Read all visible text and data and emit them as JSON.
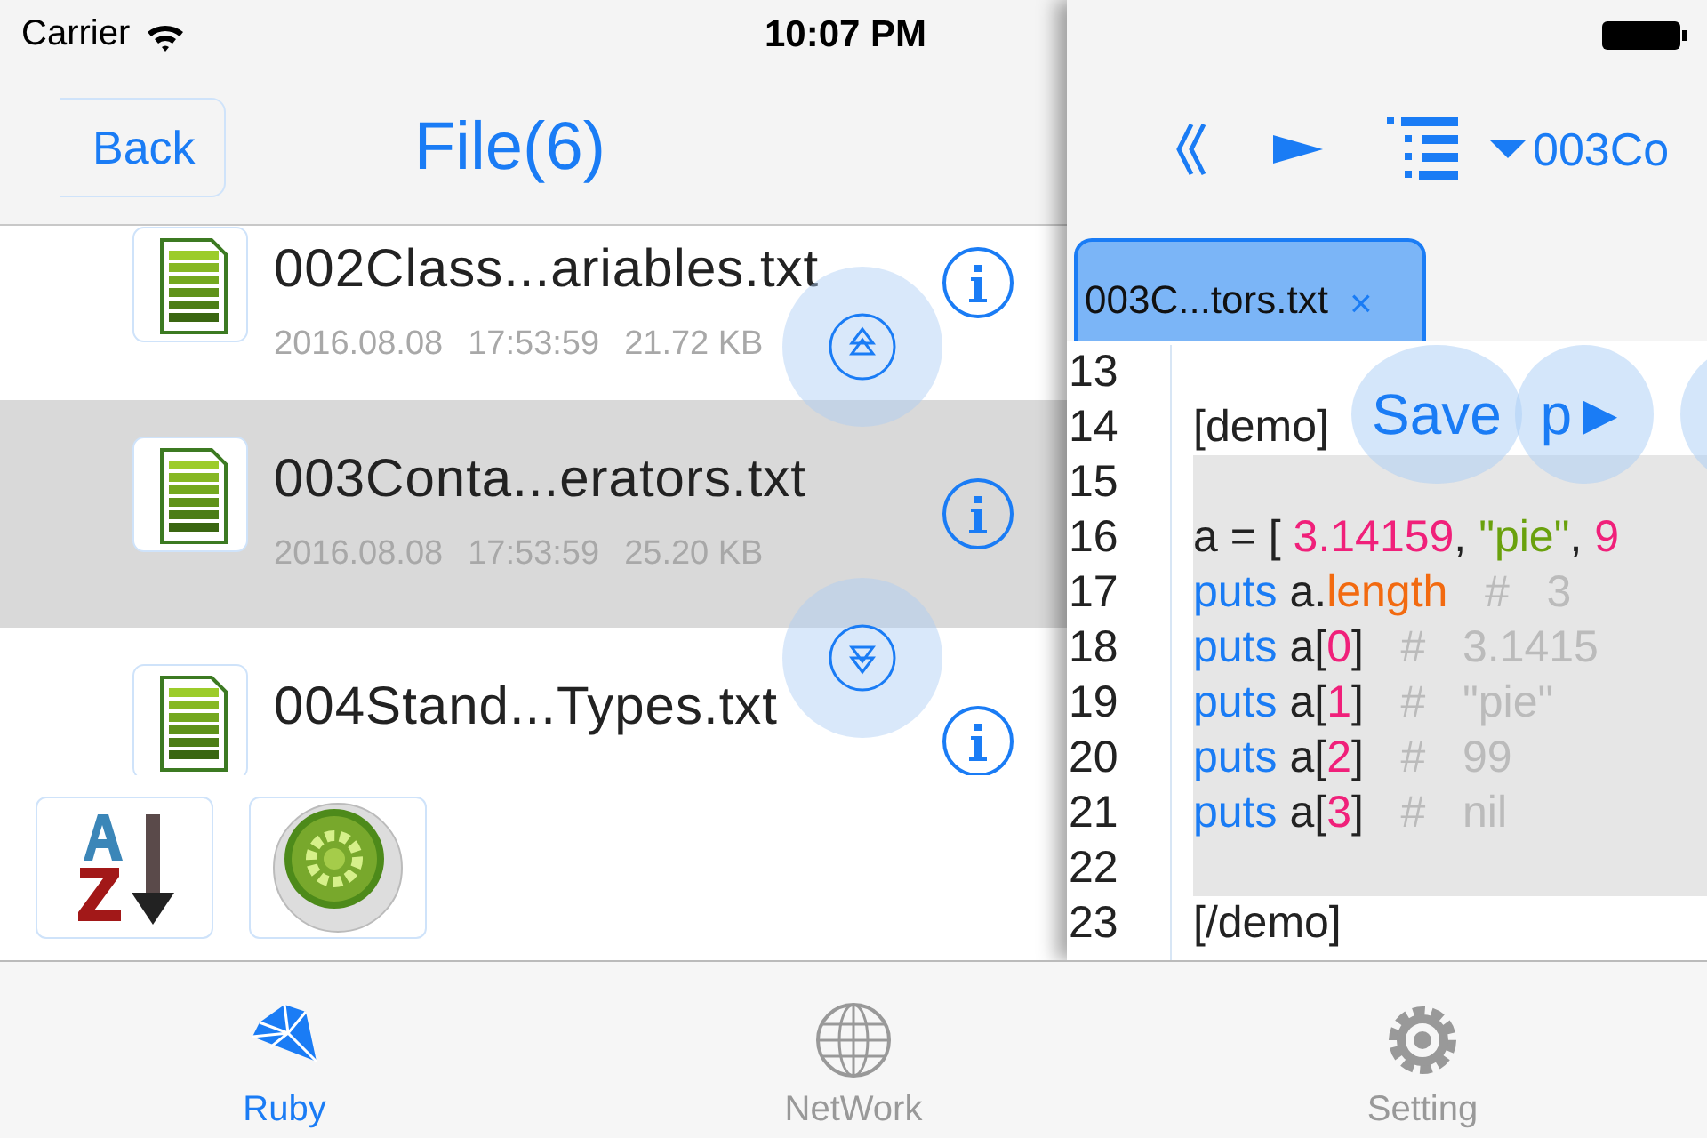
{
  "status_bar": {
    "carrier": "Carrier",
    "time": "10:07 PM"
  },
  "nav": {
    "back": "Back",
    "title": "File(6)"
  },
  "files": [
    {
      "name": "002Class...ariables.txt",
      "date": "2016.08.08",
      "time": "17:53:59",
      "size": "21.72 KB",
      "selected": false
    },
    {
      "name": "003Conta...erators.txt",
      "date": "2016.08.08",
      "time": "17:53:59",
      "size": "25.20 KB",
      "selected": true
    },
    {
      "name": "004Stand...Types.txt",
      "selected": false
    }
  ],
  "editor": {
    "title": "003Co",
    "tab": {
      "label": "003C...tors.txt",
      "close": "×"
    },
    "floating_buttons": [
      "Save",
      "p►"
    ],
    "lines": [
      {
        "number": "13",
        "shaded": false
      },
      {
        "number": "14",
        "shaded": false,
        "tokens": [
          {
            "kind": "plain",
            "text": "[demo]"
          }
        ]
      },
      {
        "number": "15",
        "shaded": true
      },
      {
        "number": "16",
        "shaded": true,
        "tokens": [
          {
            "kind": "plain",
            "text": "a = [ "
          },
          {
            "kind": "number",
            "text": "3.14159"
          },
          {
            "kind": "plain",
            "text": ", "
          },
          {
            "kind": "string",
            "text": "\"pie\""
          },
          {
            "kind": "plain",
            "text": ", "
          },
          {
            "kind": "number",
            "text": "9"
          }
        ]
      },
      {
        "number": "17",
        "shaded": true,
        "tokens": [
          {
            "kind": "keyword",
            "text": "puts"
          },
          {
            "kind": "plain",
            "text": " a."
          },
          {
            "kind": "method",
            "text": "length"
          },
          {
            "kind": "comment",
            "text": "   #   3"
          }
        ]
      },
      {
        "number": "18",
        "shaded": true,
        "tokens": [
          {
            "kind": "keyword",
            "text": "puts"
          },
          {
            "kind": "plain",
            "text": " a["
          },
          {
            "kind": "number",
            "text": "0"
          },
          {
            "kind": "plain",
            "text": "]"
          },
          {
            "kind": "comment",
            "text": "   #   3.1415"
          }
        ]
      },
      {
        "number": "19",
        "shaded": true,
        "tokens": [
          {
            "kind": "keyword",
            "text": "puts"
          },
          {
            "kind": "plain",
            "text": " a["
          },
          {
            "kind": "number",
            "text": "1"
          },
          {
            "kind": "plain",
            "text": "]"
          },
          {
            "kind": "comment",
            "text": "   #   \"pie\""
          }
        ]
      },
      {
        "number": "20",
        "shaded": true,
        "tokens": [
          {
            "kind": "keyword",
            "text": "puts"
          },
          {
            "kind": "plain",
            "text": " a["
          },
          {
            "kind": "number",
            "text": "2"
          },
          {
            "kind": "plain",
            "text": "]"
          },
          {
            "kind": "comment",
            "text": "   #   99"
          }
        ]
      },
      {
        "number": "21",
        "shaded": true,
        "tokens": [
          {
            "kind": "keyword",
            "text": "puts"
          },
          {
            "kind": "plain",
            "text": " a["
          },
          {
            "kind": "number",
            "text": "3"
          },
          {
            "kind": "plain",
            "text": "]"
          },
          {
            "kind": "comment",
            "text": "   #   nil"
          }
        ]
      },
      {
        "number": "22",
        "shaded": true
      },
      {
        "number": "23",
        "shaded": false,
        "tokens": [
          {
            "kind": "plain",
            "text": "[/demo]"
          }
        ]
      }
    ]
  },
  "tab_bar": [
    {
      "label": "Ruby",
      "selected": true
    },
    {
      "label": "NetWork",
      "selected": false
    },
    {
      "label": "Setting",
      "selected": false
    }
  ]
}
